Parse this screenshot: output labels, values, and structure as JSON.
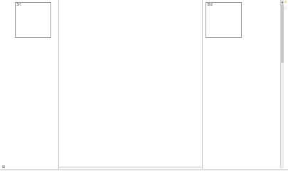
{
  "panes": {
    "left": {
      "thumbnail": {
        "label": "3rl"
      }
    },
    "center": {},
    "right": {
      "thumbnail": {
        "label": "3ld"
      }
    }
  },
  "sidebar_icons": [
    {
      "name": "warning-icon",
      "glyph": "⚠"
    },
    {
      "name": "info-icon",
      "glyph": "ⓘ"
    }
  ],
  "statusbar": {
    "grid_glyph": "⊞"
  },
  "scrollbar": {
    "arrow_up_glyph": "▲"
  }
}
